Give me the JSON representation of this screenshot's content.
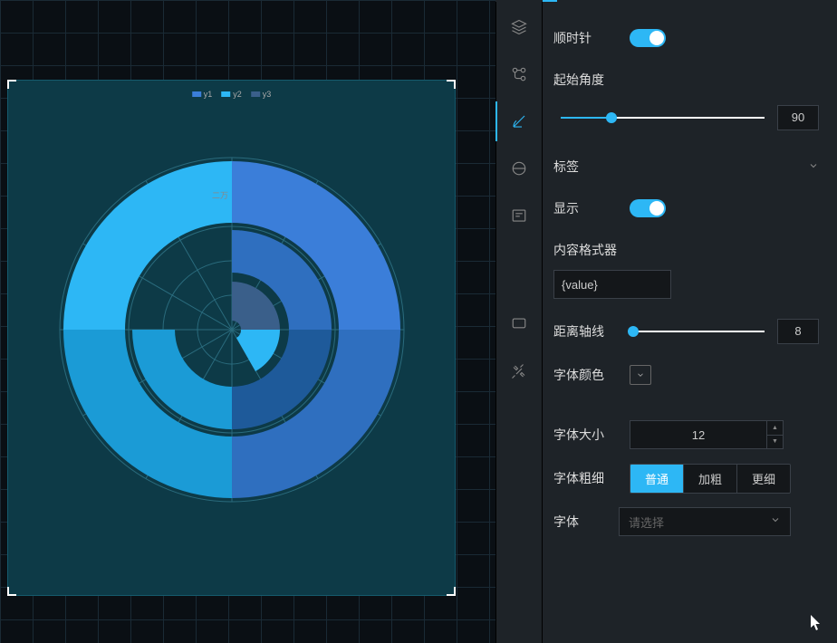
{
  "chart_data": {
    "type": "radar-rose",
    "legend": [
      {
        "name": "y1",
        "color": "#3b7ed9"
      },
      {
        "name": "y2",
        "color": "#2db7f5"
      },
      {
        "name": "y3",
        "color": "#3a5f8a"
      }
    ],
    "rings": 5,
    "spokes": 12,
    "start_angle": 90,
    "clockwise": true,
    "tick_label": "二万",
    "series": [
      {
        "name": "y1",
        "segments": [
          {
            "start": 0,
            "end": 360,
            "inner": 0.62,
            "outer": 0.98
          }
        ]
      },
      {
        "name": "y2",
        "segments": [
          {
            "start": 90,
            "end": 360,
            "inner": 0.33,
            "outer": 0.58
          }
        ]
      },
      {
        "name": "y3",
        "segments": [
          {
            "start": 90,
            "end": 200,
            "inner": 0.05,
            "outer": 0.28
          }
        ]
      }
    ]
  },
  "panel": {
    "clockwise": {
      "label": "顺时针",
      "value": true
    },
    "start_angle": {
      "label": "起始角度",
      "value": 90,
      "slider_pos": 25
    },
    "tag_section": "标签",
    "show": {
      "label": "显示",
      "value": true
    },
    "content_formatter": {
      "label": "内容格式器",
      "value": "{value}"
    },
    "axis_distance": {
      "label": "距离轴线",
      "value": 8,
      "slider_pos": 3
    },
    "font_color": {
      "label": "字体颜色"
    },
    "font_size": {
      "label": "字体大小",
      "value": 12
    },
    "font_weight": {
      "label": "字体粗细",
      "options": [
        "普通",
        "加粗",
        "更细"
      ],
      "active": "普通"
    },
    "font_family": {
      "label": "字体",
      "placeholder": "请选择"
    }
  }
}
